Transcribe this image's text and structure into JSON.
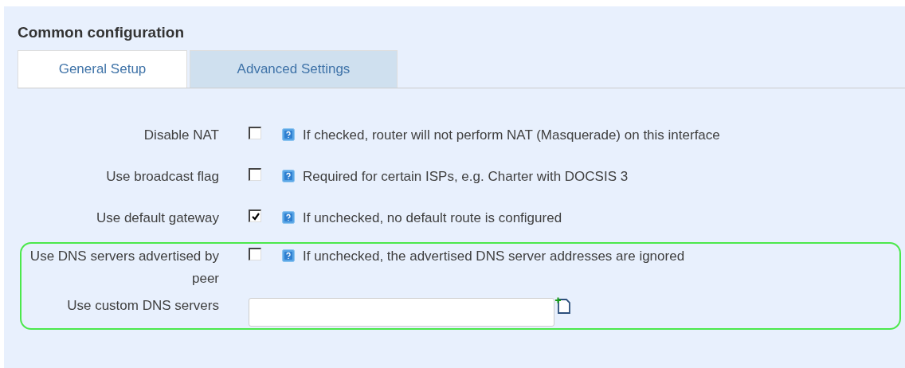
{
  "section": {
    "title": "Common configuration"
  },
  "tabs": [
    {
      "label": "General Setup",
      "selected": false
    },
    {
      "label": "Advanced Settings",
      "selected": true
    }
  ],
  "rows": [
    {
      "kind": "checkbox",
      "label": "Disable NAT",
      "checked": false,
      "help": "If checked, router will not perform NAT (Masquerade) on this interface"
    },
    {
      "kind": "checkbox",
      "label": "Use broadcast flag",
      "checked": false,
      "help": "Required for certain ISPs, e.g. Charter with DOCSIS 3"
    },
    {
      "kind": "checkbox",
      "label": "Use default gateway",
      "checked": true,
      "help": "If unchecked, no default route is configured"
    }
  ],
  "highlighted_rows": [
    {
      "kind": "checkbox",
      "label": "Use DNS servers advertised by peer",
      "checked": false,
      "help": "If unchecked, the advertised DNS server addresses are ignored"
    },
    {
      "kind": "list",
      "label": "Use custom DNS servers"
    }
  ]
}
